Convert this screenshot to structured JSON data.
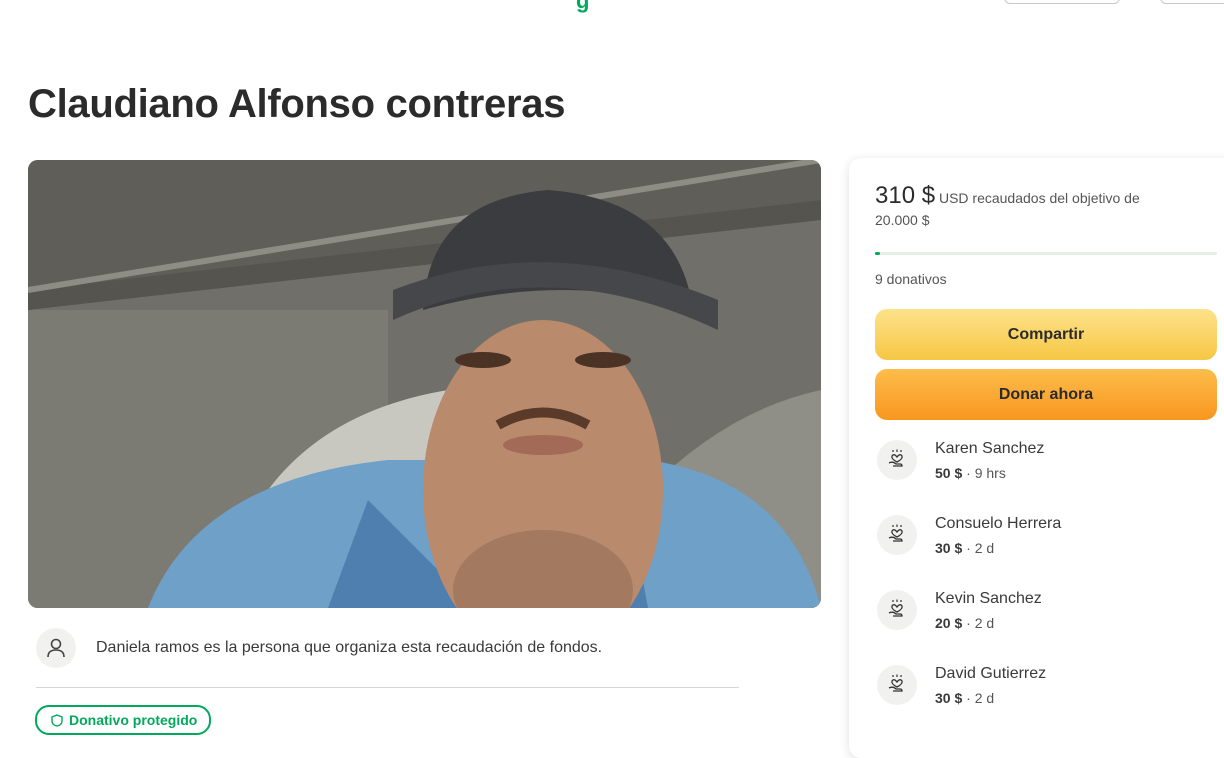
{
  "header": {
    "logo_fragment": "g"
  },
  "campaign": {
    "title": "Claudiano Alfonso contreras",
    "organizer_text": "Daniela ramos es la persona que organiza esta recaudación de fondos.",
    "badge_label": "Donativo protegido"
  },
  "sidebar": {
    "raised_amount": "310 $",
    "raised_label": "USD recaudados del objetivo de",
    "goal": "20.000 $",
    "progress_fraction": 0.0155,
    "donations_count": "9 donativos",
    "share_label": "Compartir",
    "donate_label": "Donar ahora",
    "donors": [
      {
        "name": "Karen Sanchez",
        "amount": "50 $",
        "time": "9 hrs"
      },
      {
        "name": "Consuelo Herrera",
        "amount": "30 $",
        "time": "2 d"
      },
      {
        "name": "Kevin Sanchez",
        "amount": "20 $",
        "time": "2 d"
      },
      {
        "name": "David Gutierrez",
        "amount": "30 $",
        "time": "2 d"
      }
    ],
    "separator": "·"
  },
  "colors": {
    "brand_green": "#02a95c",
    "share_yellow": "#f6c744",
    "donate_orange": "#f8971f"
  },
  "icons": {
    "organizer": "user-outline-icon",
    "donor": "heart-hand-icon",
    "badge": "shield-check-icon"
  }
}
